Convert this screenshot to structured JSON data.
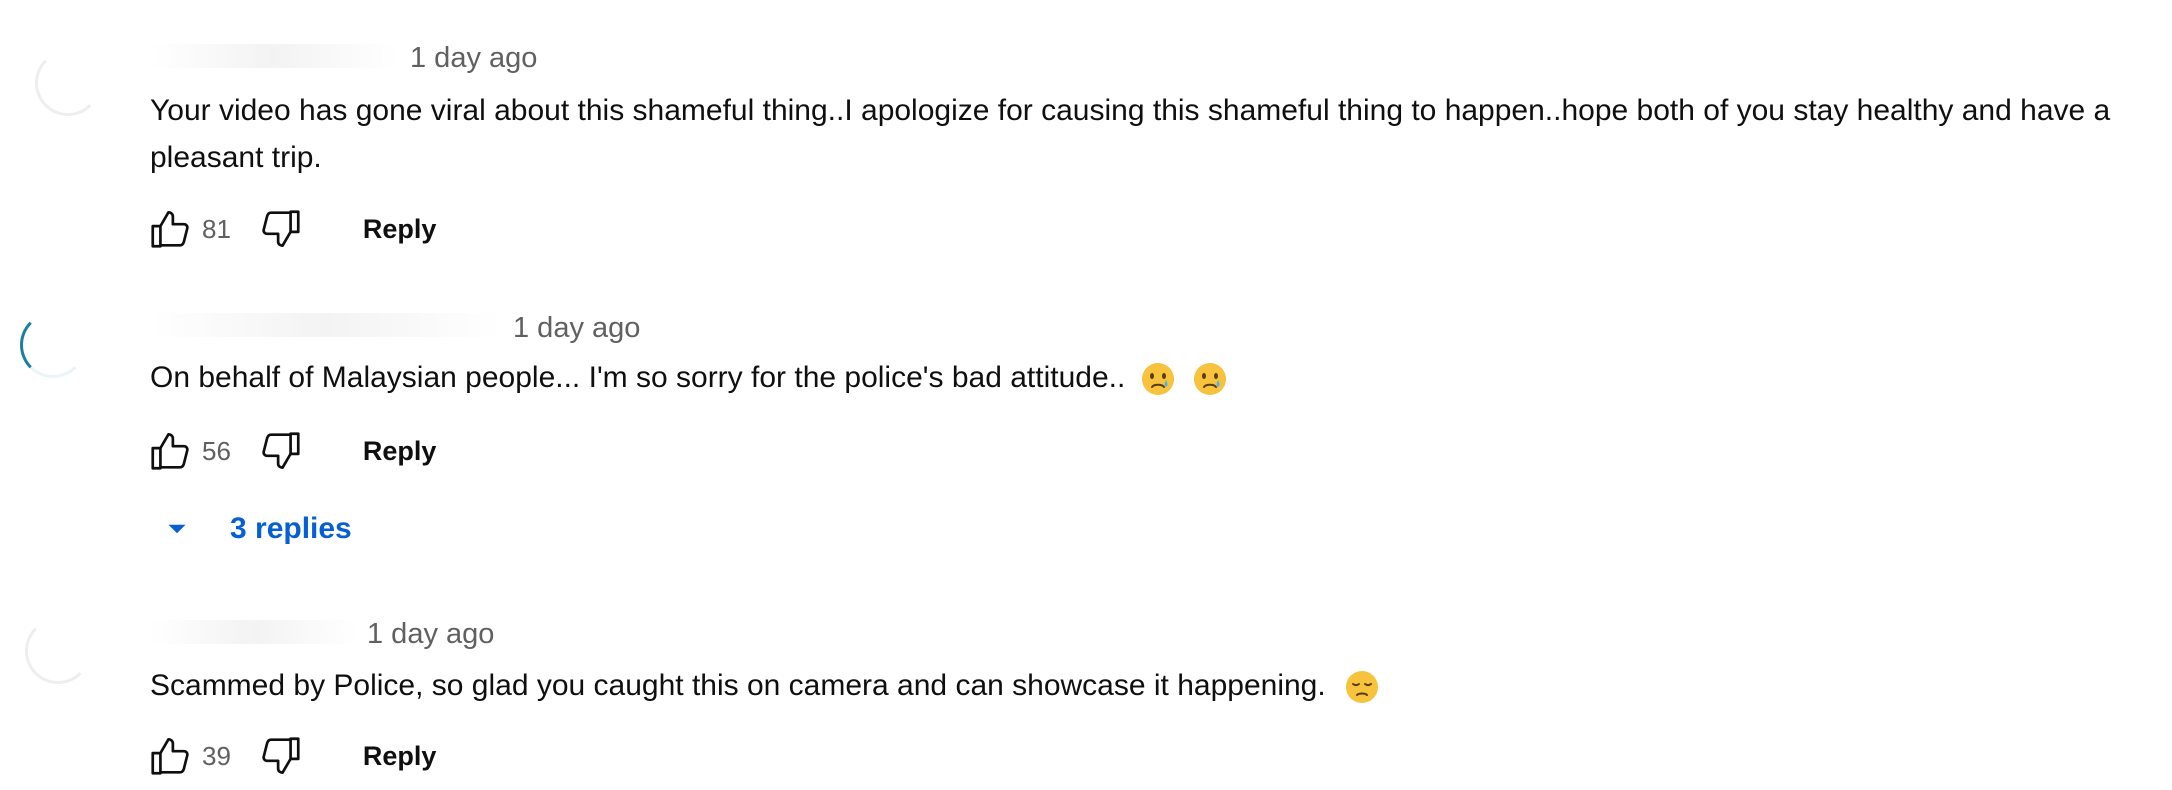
{
  "comments": [
    {
      "time": "1 day ago",
      "text": "Your video has gone viral about this shameful thing..I apologize for causing this shameful thing to happen..hope both of you stay healthy and have a pleasant trip.",
      "likes": "81",
      "reply_label": "Reply"
    },
    {
      "time": "1 day ago",
      "text": "On behalf of Malaysian people... I'm so sorry for the police's bad attitude..",
      "likes": "56",
      "reply_label": "Reply",
      "replies_label": "3 replies",
      "emojis": [
        "crying-face",
        "crying-face"
      ]
    },
    {
      "time": "1 day ago",
      "text": "Scammed by Police, so glad you caught this on camera and can showcase it happening.",
      "likes": "39",
      "reply_label": "Reply",
      "emojis": [
        "disappointed-face"
      ]
    }
  ],
  "colors": {
    "text": "#0f0f0f",
    "secondary": "#606060",
    "link_blue": "#065fd4",
    "emoji_yellow": "#f7c23c"
  },
  "icons": [
    "like-icon",
    "dislike-icon",
    "caret-down-icon",
    "crying-face-emoji",
    "disappointed-face-emoji"
  ]
}
